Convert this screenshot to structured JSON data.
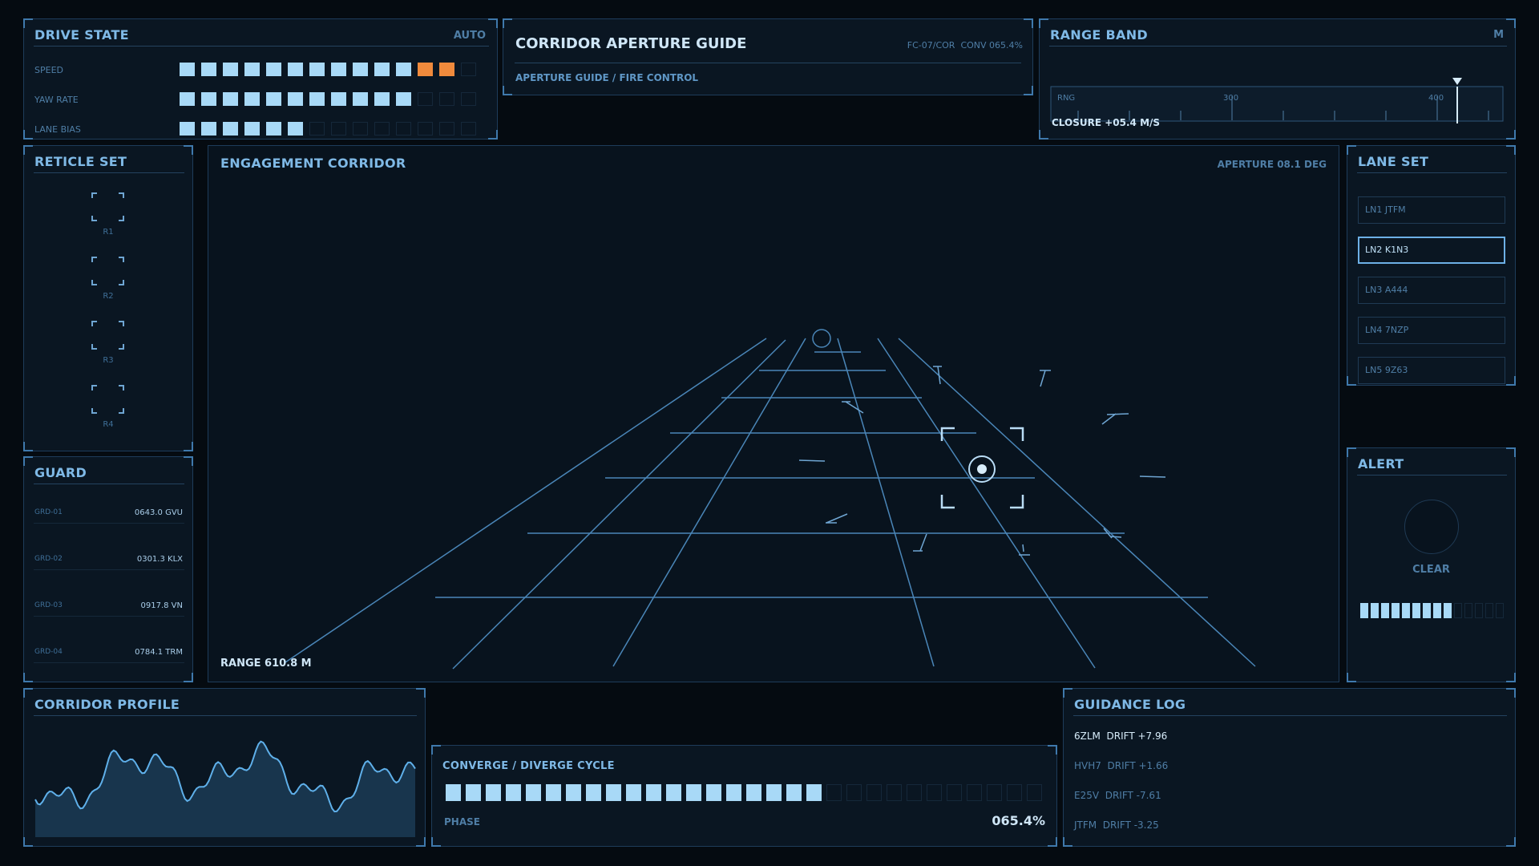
{
  "drive_state": {
    "title": "DRIVE STATE",
    "mode": "AUTO",
    "rows": [
      {
        "label": "SPEED",
        "segments": [
          "on",
          "on",
          "on",
          "on",
          "on",
          "on",
          "on",
          "on",
          "on",
          "on",
          "on",
          "warn",
          "warn",
          "off"
        ]
      },
      {
        "label": "YAW RATE",
        "segments": [
          "on",
          "on",
          "on",
          "on",
          "on",
          "on",
          "on",
          "on",
          "on",
          "on",
          "on",
          "off",
          "off",
          "off"
        ]
      },
      {
        "label": "LANE BIAS",
        "segments": [
          "on",
          "on",
          "on",
          "on",
          "on",
          "on",
          "off",
          "off",
          "off",
          "off",
          "off",
          "off",
          "off",
          "off"
        ]
      }
    ]
  },
  "header": {
    "title": "CORRIDOR APERTURE GUIDE",
    "code": "FC-07/COR",
    "conv": "CONV 065.4%",
    "subtitle": "APERTURE GUIDE / FIRE CONTROL"
  },
  "range_band": {
    "title": "RANGE BAND",
    "unit": "M",
    "scale_label": "RNG",
    "tick_300": "300",
    "tick_400": "400",
    "closure": "CLOSURE +05.4 M/S"
  },
  "reticle_set": {
    "title": "RETICLE SET",
    "items": [
      "R1",
      "R2",
      "R3",
      "R4"
    ]
  },
  "guard": {
    "title": "GUARD",
    "rows": [
      {
        "id": "GRD-01",
        "value": "0643.0 GVU"
      },
      {
        "id": "GRD-02",
        "value": "0301.3 KLX"
      },
      {
        "id": "GRD-03",
        "value": "0917.8 VN"
      },
      {
        "id": "GRD-04",
        "value": "0784.1 TRM"
      }
    ]
  },
  "engagement": {
    "title": "ENGAGEMENT CORRIDOR",
    "aperture": "APERTURE 08.1 DEG",
    "range": "RANGE 610.8 M"
  },
  "lane_set": {
    "title": "LANE SET",
    "items": [
      {
        "label": "LN1 JTFM",
        "selected": false
      },
      {
        "label": "LN2 K1N3",
        "selected": true
      },
      {
        "label": "LN3 A444",
        "selected": false
      },
      {
        "label": "LN4 7NZP",
        "selected": false
      },
      {
        "label": "LN5 9Z63",
        "selected": false
      }
    ]
  },
  "alert": {
    "title": "ALERT",
    "status": "CLEAR",
    "level_fraction": 0.7
  },
  "corridor_profile": {
    "title": "CORRIDOR PROFILE"
  },
  "cycle": {
    "title": "CONVERGE / DIVERGE CYCLE",
    "phase_label": "PHASE",
    "phase_value": "065.4%",
    "fraction": 0.654
  },
  "guidance_log": {
    "title": "GUIDANCE LOG",
    "entries": [
      {
        "id": "6ZLM",
        "drift": "DRIFT +7.96",
        "active": true
      },
      {
        "id": "HVH7",
        "drift": "DRIFT +1.66",
        "active": false
      },
      {
        "id": "E25V",
        "drift": "DRIFT -7.61",
        "active": false
      },
      {
        "id": "JTFM",
        "drift": "DRIFT -3.25",
        "active": false
      }
    ]
  },
  "colors": {
    "accent": "#7fb9e6",
    "segment_on": "#a8d9f7",
    "segment_warn": "#f08a3c",
    "grid_line": "#4a86b8"
  }
}
